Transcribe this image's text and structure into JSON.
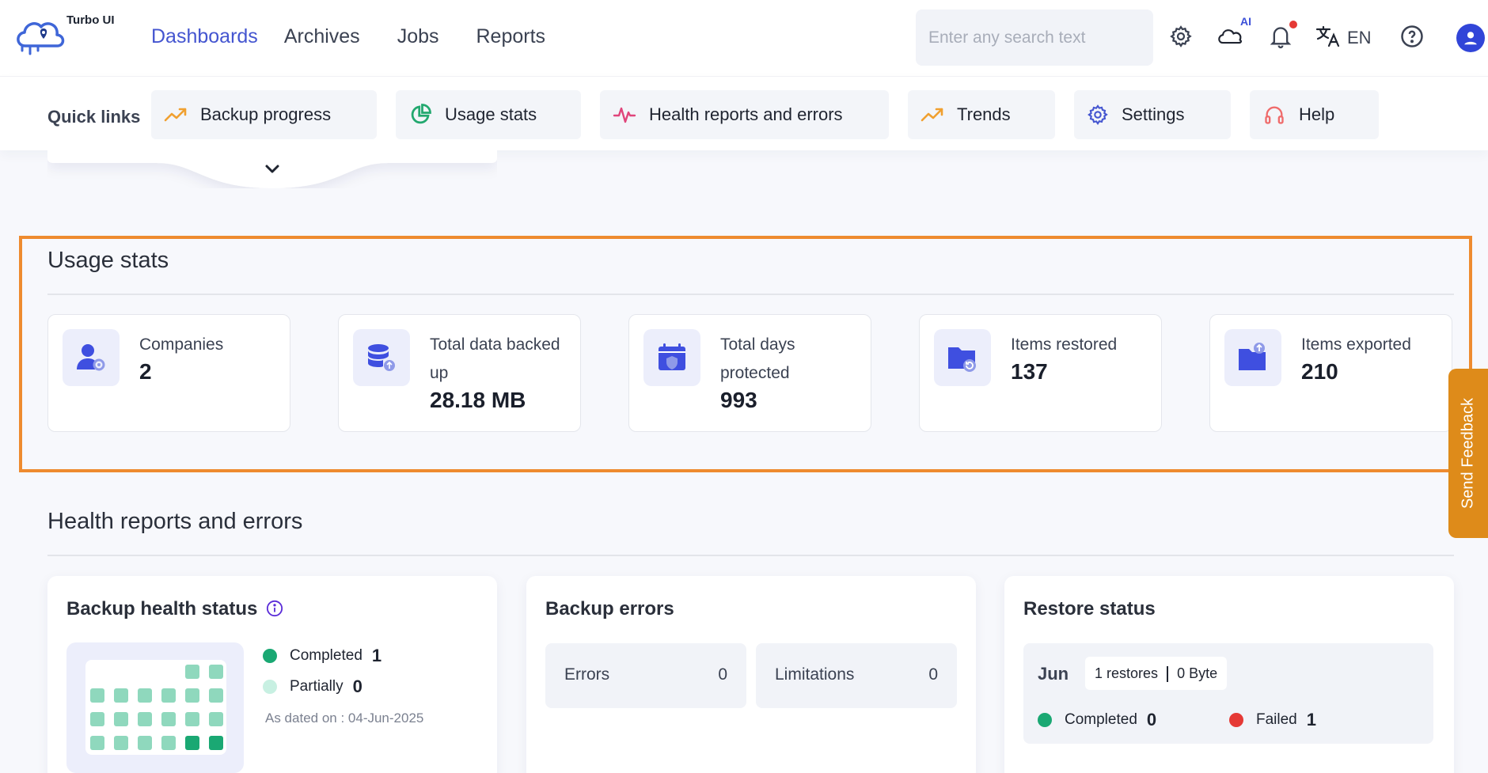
{
  "app": {
    "name": "Turbo UI"
  },
  "nav": {
    "items": [
      {
        "label": "Dashboards",
        "active": true
      },
      {
        "label": "Archives",
        "active": false
      },
      {
        "label": "Jobs",
        "active": false
      },
      {
        "label": "Reports",
        "active": false
      }
    ]
  },
  "search": {
    "placeholder": "Enter any search text",
    "value": ""
  },
  "toolbar": {
    "ai_tag": "AI",
    "language": "EN",
    "has_notification": true
  },
  "quick_links": {
    "title": "Quick links",
    "items": [
      {
        "label": "Backup progress",
        "icon": "trending-up-icon",
        "color": "#f0a030"
      },
      {
        "label": "Usage stats",
        "icon": "pie-chart-icon",
        "color": "#22a86f"
      },
      {
        "label": "Health reports and errors",
        "icon": "pulse-icon",
        "color": "#e0457b"
      },
      {
        "label": "Trends",
        "icon": "trending-up-icon",
        "color": "#f0a030"
      },
      {
        "label": "Settings",
        "icon": "gear-icon",
        "color": "#4455d0"
      },
      {
        "label": "Help",
        "icon": "headset-icon",
        "color": "#ef6b6b"
      }
    ]
  },
  "usage_stats": {
    "title": "Usage stats",
    "cards": [
      {
        "label": "Companies",
        "value": "2",
        "icon": "user-gear-icon"
      },
      {
        "label": "Total data backed up",
        "value": "28.18 MB",
        "icon": "database-icon"
      },
      {
        "label": "Total days protected",
        "value": "993",
        "icon": "calendar-shield-icon"
      },
      {
        "label": "Items restored",
        "value": "137",
        "icon": "folder-restore-icon"
      },
      {
        "label": "Items exported",
        "value": "210",
        "icon": "folder-export-icon"
      }
    ]
  },
  "feedback": {
    "label": "Send Feedback"
  },
  "health": {
    "title": "Health reports and errors",
    "backup_health": {
      "title": "Backup health status",
      "completed_label": "Completed",
      "completed_value": "1",
      "partially_label": "Partially",
      "partially_value": "0",
      "as_of": "As dated on : 04-Jun-2025"
    },
    "backup_errors": {
      "title": "Backup errors",
      "errors_label": "Errors",
      "errors_value": "0",
      "limitations_label": "Limitations",
      "limitations_value": "0"
    },
    "restore_status": {
      "title": "Restore status",
      "month": "Jun",
      "restores_text": "1 restores",
      "size_text": "0 Byte",
      "completed_label": "Completed",
      "completed_value": "0",
      "failed_label": "Failed",
      "failed_value": "1"
    }
  },
  "colors": {
    "accent": "#4455d0",
    "highlight": "#ee8b2f",
    "completed": "#1aa873",
    "partial": "#c8f0e2",
    "failed": "#e53935",
    "feedback": "#de8b1a"
  }
}
